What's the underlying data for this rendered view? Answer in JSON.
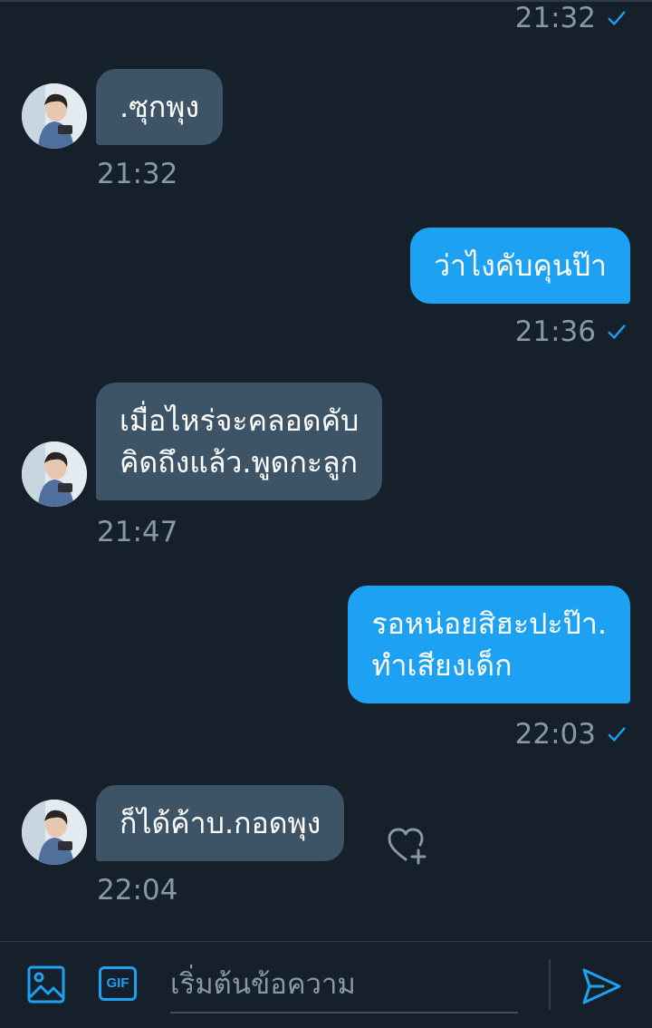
{
  "messages": [
    {
      "type": "meta",
      "time": "21:32"
    },
    {
      "type": "in",
      "lines": [
        ".ซุกพุง"
      ],
      "time": "21:32"
    },
    {
      "type": "out",
      "lines": [
        "ว่าไงคับคุนป๊า"
      ],
      "time": "21:36"
    },
    {
      "type": "in",
      "lines": [
        "เมื่อไหร่จะคลอดคับ",
        "คิดถึงแล้ว.พูดกะลูก"
      ],
      "time": "21:47"
    },
    {
      "type": "out",
      "lines": [
        "รอหน่อยสิฮะปะป๊า.",
        "ทำเสียงเด็ก"
      ],
      "time": "22:03"
    },
    {
      "type": "in",
      "lines": [
        "ก็ได้ค้าบ.กอดพุง"
      ],
      "time": "22:04"
    }
  ],
  "composer": {
    "placeholder": "เริ่มต้นข้อความ",
    "gif_label": "GIF",
    "icons": [
      "image-icon",
      "gif-icon",
      "send-icon"
    ]
  },
  "colors": {
    "background": "#15202b",
    "incoming_bubble": "#3d5466",
    "outgoing_bubble": "#1da1f2",
    "accent": "#1da1f2",
    "meta_text": "#8899a6"
  }
}
